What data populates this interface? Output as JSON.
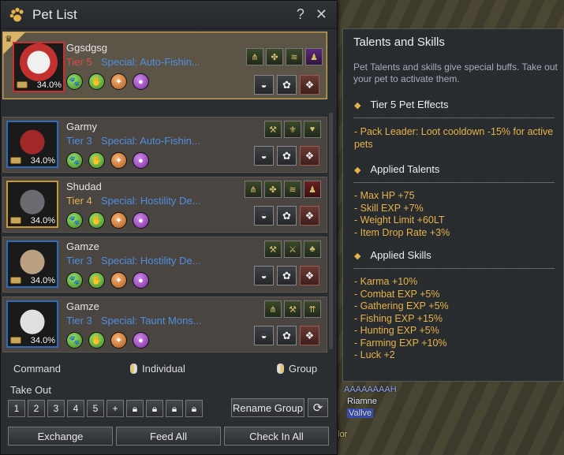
{
  "window": {
    "title": "Pet List",
    "help": "?",
    "close": "✕"
  },
  "pets": [
    {
      "name": "Ggsdgsg",
      "tier": "Tier 5",
      "special": "Special: Auto-Fishin...",
      "hunger": "34.0%"
    },
    {
      "name": "Garmy",
      "tier": "Tier 3",
      "special": "Special: Auto-Fishin...",
      "hunger": "34.0%"
    },
    {
      "name": "Shudad",
      "tier": "Tier 4",
      "special": "Special: Hostility De...",
      "hunger": "34.0%"
    },
    {
      "name": "Gamze",
      "tier": "Tier 3",
      "special": "Special: Hostility De...",
      "hunger": "34.0%"
    },
    {
      "name": "Gamze",
      "tier": "Tier 3",
      "special": "Special: Taunt Mons...",
      "hunger": "34.0%"
    }
  ],
  "command": {
    "label": "Command",
    "individual": "Individual",
    "group": "Group"
  },
  "takeout": {
    "label": "Take Out",
    "slots": [
      "1",
      "2",
      "3",
      "4",
      "5",
      "+"
    ]
  },
  "buttons": {
    "rename_group": "Rename Group",
    "exchange": "Exchange",
    "feed_all": "Feed All",
    "check_in_all": "Check In All"
  },
  "tooltip": {
    "title": "Talents and Skills",
    "desc": "Pet Talents and skills give special buffs. Take out your pet to activate them.",
    "tier_section": "Tier 5 Pet Effects",
    "tier_effects": [
      "- Pack Leader: Loot cooldown -15% for active",
      "pets"
    ],
    "talents_section": "Applied Talents",
    "talents": [
      "- Max HP +75",
      "- Skill EXP +7%",
      "- Weight Limit +60LT",
      "- Item Drop Rate +3%"
    ],
    "skills_section": "Applied Skills",
    "skills": [
      "- Karma +10%",
      "- Combat EXP +5%",
      "- Gathering EXP +5%",
      "- Fishing EXP +15%",
      "- Hunting EXP +5%",
      "- Farming EXP +10%",
      "- Luck +2"
    ]
  },
  "background": {
    "labels": [
      "AAAAAAAAH",
      "Riamne",
      "Vallve",
      "lor"
    ]
  }
}
